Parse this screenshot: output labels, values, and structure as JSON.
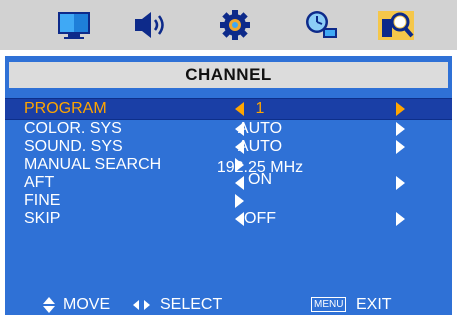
{
  "top_icons": [
    {
      "name": "picture-icon"
    },
    {
      "name": "sound-icon"
    },
    {
      "name": "settings-gear-icon"
    },
    {
      "name": "time-clock-icon"
    },
    {
      "name": "channel-search-icon"
    }
  ],
  "title": "CHANNEL",
  "rows": [
    {
      "label": "PROGRAM",
      "value": "1"
    },
    {
      "label": "COLOR. SYS",
      "value": "AUTO"
    },
    {
      "label": "SOUND. SYS",
      "value": "AUTO"
    },
    {
      "label": "MANUAL SEARCH",
      "value": "192.25 MHz"
    },
    {
      "label": "AFT",
      "value": "ON"
    },
    {
      "label": "FINE",
      "value": ""
    },
    {
      "label": "SKIP",
      "value": "OFF"
    }
  ],
  "footer": {
    "move_label": "MOVE",
    "select_label": "SELECT",
    "menu_key": "MENU",
    "exit_label": "EXIT"
  },
  "colors": {
    "panel_blue": "#2f71d6",
    "selected_row": "#1a3fa6",
    "selected_text": "#ffa500",
    "top_bar": "#d2d2d2",
    "title_bar": "#dcdcdc"
  }
}
